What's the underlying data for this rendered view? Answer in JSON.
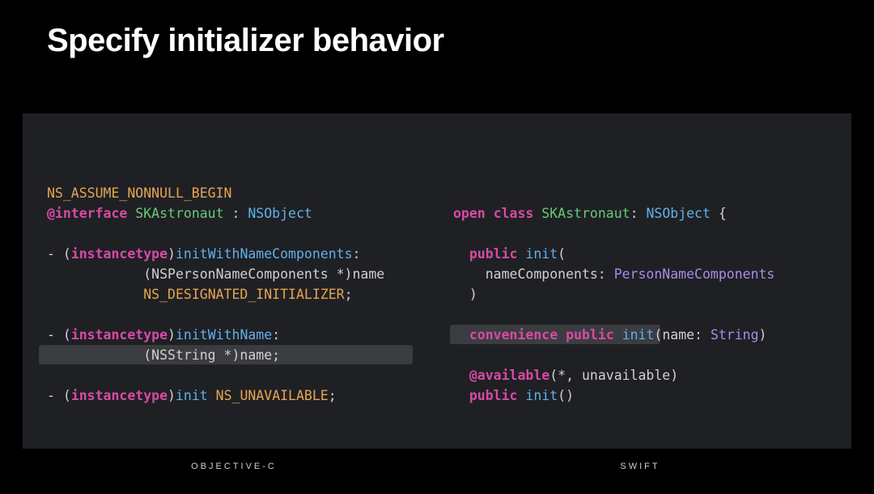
{
  "title": "Specify initializer behavior",
  "left": {
    "lang_label": "OBJECTIVE-C",
    "line1_macro": "NS_ASSUME_NONNULL_BEGIN",
    "iface_kw": "@interface",
    "iface_name": "SKAstronaut",
    "colon": " : ",
    "iface_super": "NSObject",
    "dash": "- (",
    "instancetype": "instancetype",
    "rparen": ")",
    "m1_name": "initWithNameComponents",
    "m1_body": ":\n            (NSPersonNameComponents *)name\n            ",
    "m1_anno": "NS_DESIGNATED_INITIALIZER",
    "m1_end": ";",
    "m2_name": "initWithName",
    "m2_body": ":\n            (NSString *)name;",
    "m3_name": "init",
    "m3_space": " ",
    "m3_anno": "NS_UNAVAILABLE",
    "m3_end": ";"
  },
  "right": {
    "lang_label": "SWIFT",
    "open": "open",
    "class": "class",
    "cls_name": "SKAstronaut",
    "colon": ": ",
    "cls_super": "NSObject",
    "brace": " {",
    "public1": "public",
    "init1": "init",
    "m1_open": "(",
    "m1_arg": "    nameComponents: ",
    "m1_type": "PersonNameComponents",
    "m1_close": "  )",
    "convenience": "convenience",
    "public2": "public",
    "init2": "init",
    "m2_sig_open": "(name: ",
    "m2_type": "String",
    "m2_sig_close": ")",
    "avail_kw": "@available",
    "avail_args": "(*, unavailable)",
    "public3": "public",
    "init3": "init",
    "m3_sig": "()"
  }
}
